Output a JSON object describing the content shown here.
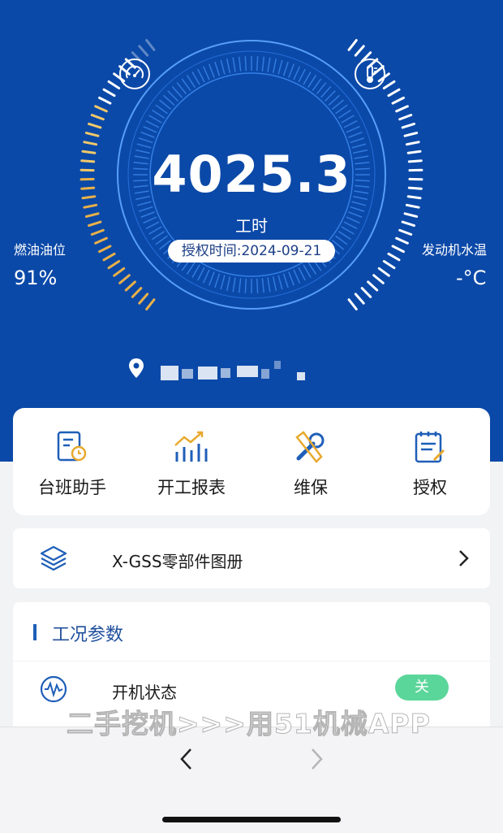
{
  "dashboard": {
    "hours_value": "4025.3",
    "hours_unit": "工时",
    "auth_time": "授权时间:2024-09-21",
    "fuel_label": "燃油油位",
    "fuel_value": "91%",
    "fuel_level_percent": 91,
    "temp_label": "发动机水温",
    "temp_value": "-°C",
    "gauge_left_icon": "speedometer-icon",
    "gauge_right_icon": "thermometer-icon",
    "location_icon": "location-pin-icon"
  },
  "quick_actions": [
    {
      "label": "台班助手",
      "icon": "shift-assistant-icon"
    },
    {
      "label": "开工报表",
      "icon": "bar-chart-icon"
    },
    {
      "label": "维保",
      "icon": "wrench-icon"
    },
    {
      "label": "授权",
      "icon": "authorize-document-icon"
    }
  ],
  "catalog": {
    "label": "X-GSS零部件图册",
    "icon": "layers-icon",
    "chevron": "chevron-right-icon"
  },
  "section": {
    "title": "工况参数"
  },
  "status_row": {
    "label": "开机状态",
    "icon": "waveform-icon",
    "toggle_text": "关"
  },
  "watermark": "二手挖机>>>用51机械APP",
  "colors": {
    "brand_blue": "#0b49a8",
    "toggle_green": "#5bd69a",
    "fuel_gradient_start": "#e8b04a",
    "temp_ticks": "#ffffff"
  },
  "browser_nav": {
    "back_icon": "chevron-left-icon",
    "forward_icon": "chevron-right-icon"
  }
}
